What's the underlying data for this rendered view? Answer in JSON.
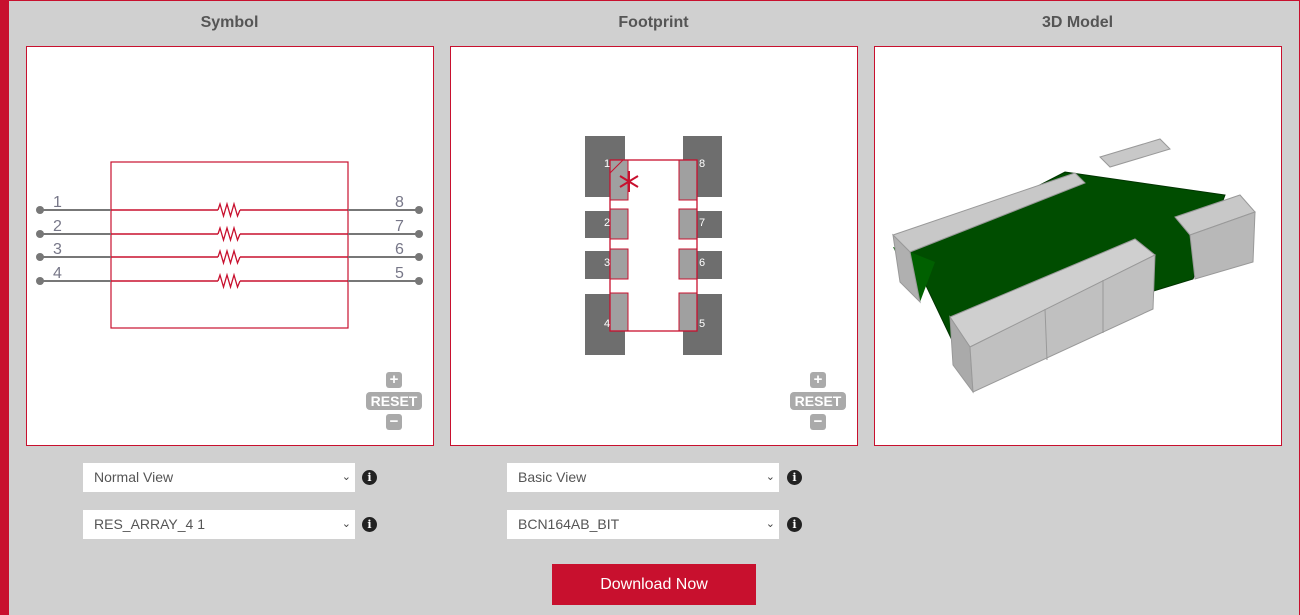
{
  "titles": {
    "symbol": "Symbol",
    "footprint": "Footprint",
    "model": "3D Model"
  },
  "symbol": {
    "pins_left": [
      "1",
      "2",
      "3",
      "4"
    ],
    "pins_right": [
      "8",
      "7",
      "6",
      "5"
    ]
  },
  "footprint": {
    "pins_left": [
      "1",
      "2",
      "3",
      "4"
    ],
    "pins_right": [
      "8",
      "7",
      "6",
      "5"
    ]
  },
  "zoom": {
    "plus": "+",
    "reset": "RESET",
    "minus": "−"
  },
  "selects": {
    "symbol_view": "Normal View",
    "symbol_variant": "RES_ARRAY_4 1",
    "footprint_view": "Basic View",
    "footprint_variant": "BCN164AB_BIT"
  },
  "info_glyph": "i",
  "download_label": "Download Now",
  "colors": {
    "accent": "#c8102e",
    "pcb_green": "#004d00"
  }
}
